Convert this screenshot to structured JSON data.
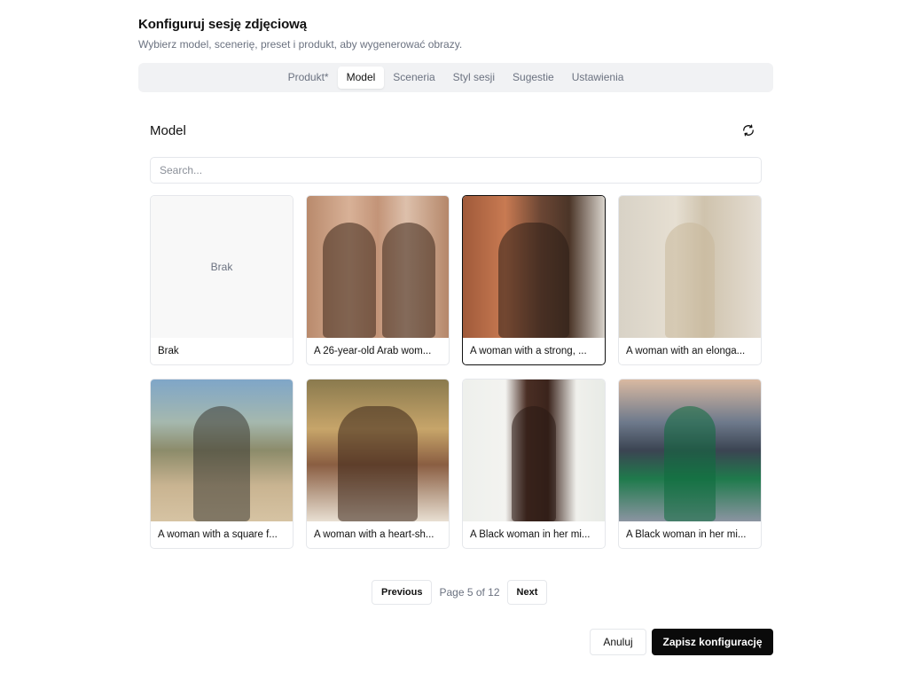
{
  "dialog": {
    "title": "Konfiguruj sesję zdjęciową",
    "subtitle": "Wybierz model, scenerię, preset i produkt, aby wygenerować obrazy."
  },
  "tabs": [
    {
      "label": "Produkt*",
      "active": false
    },
    {
      "label": "Model",
      "active": true
    },
    {
      "label": "Sceneria",
      "active": false
    },
    {
      "label": "Styl sesji",
      "active": false
    },
    {
      "label": "Sugestie",
      "active": false
    },
    {
      "label": "Ustawienia",
      "active": false
    }
  ],
  "section": {
    "title": "Model",
    "refresh_icon": "refresh-icon"
  },
  "search": {
    "placeholder": "Search...",
    "value": ""
  },
  "models": [
    {
      "label": "Brak",
      "image_text": "Brak",
      "selected": false
    },
    {
      "label": "A 26-year-old Arab wom...",
      "selected": false
    },
    {
      "label": "A woman with a strong, ...",
      "selected": true
    },
    {
      "label": "A woman with an elonga...",
      "selected": false
    },
    {
      "label": "A woman with a square f...",
      "selected": false
    },
    {
      "label": "A woman with a heart-sh...",
      "selected": false
    },
    {
      "label": "A Black woman in her mi...",
      "selected": false
    },
    {
      "label": "A Black woman in her mi...",
      "selected": false
    }
  ],
  "pagination": {
    "previous_label": "Previous",
    "page_info": "Page 5 of 12",
    "next_label": "Next"
  },
  "footer": {
    "cancel_label": "Anuluj",
    "save_label": "Zapisz konfigurację"
  }
}
